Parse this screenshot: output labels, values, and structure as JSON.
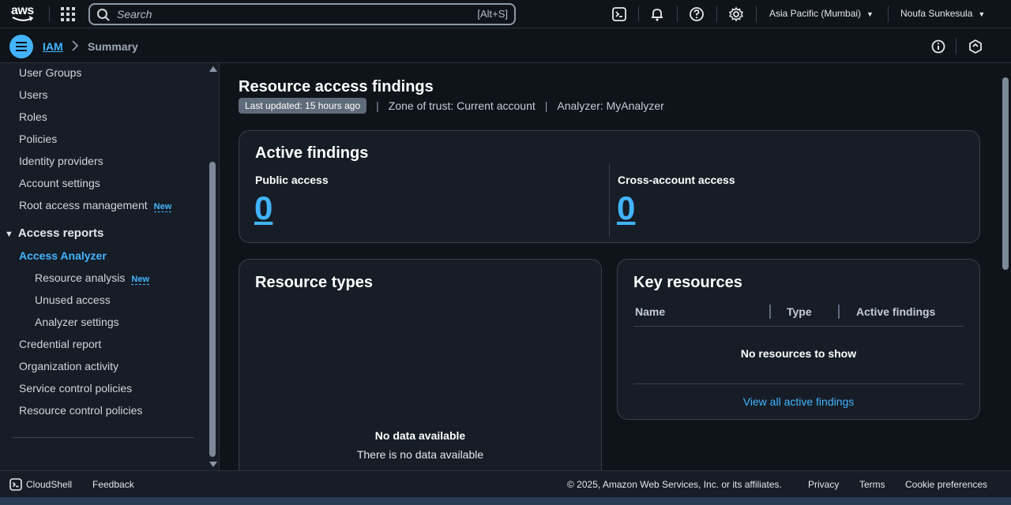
{
  "top_bar": {
    "logo_text": "aws",
    "search_placeholder": "Search",
    "search_shortcut": "[Alt+S]",
    "region": "Asia Pacific (Mumbai)",
    "user": "Noufa Sunkesula"
  },
  "breadcrumb": {
    "service": "IAM",
    "page": "Summary"
  },
  "sidebar": {
    "items": [
      {
        "label": "User Groups"
      },
      {
        "label": "Users"
      },
      {
        "label": "Roles"
      },
      {
        "label": "Policies"
      },
      {
        "label": "Identity providers"
      },
      {
        "label": "Account settings"
      },
      {
        "label": "Root access management",
        "badge": "New"
      }
    ],
    "section": "Access reports",
    "section_items": [
      {
        "label": "Access Analyzer"
      },
      {
        "label": "Resource analysis",
        "badge": "New"
      },
      {
        "label": "Unused access"
      },
      {
        "label": "Analyzer settings"
      },
      {
        "label": "Credential report"
      },
      {
        "label": "Organization activity"
      },
      {
        "label": "Service control policies"
      },
      {
        "label": "Resource control policies"
      }
    ]
  },
  "main": {
    "title": "Resource access findings",
    "last_updated": "Last updated: 15 hours ago",
    "zone": "Zone of trust: Current account",
    "analyzer": "Analyzer: MyAnalyzer",
    "active_findings": {
      "title": "Active findings",
      "public_label": "Public access",
      "public_value": "0",
      "cross_label": "Cross-account access",
      "cross_value": "0"
    },
    "resource_types": {
      "title": "Resource types",
      "nodata_title": "No data available",
      "nodata_sub": "There is no data available"
    },
    "key_resources": {
      "title": "Key resources",
      "columns": [
        "Name",
        "Type",
        "Active findings"
      ],
      "empty": "No resources to show",
      "link": "View all active findings"
    }
  },
  "footer": {
    "cloudshell": "CloudShell",
    "feedback": "Feedback",
    "copyright": "© 2025, Amazon Web Services, Inc. or its affiliates.",
    "privacy": "Privacy",
    "terms": "Terms",
    "cookies": "Cookie preferences"
  },
  "colors": {
    "accent": "#42b4ff",
    "background": "#0f141a",
    "panel": "#161d26"
  }
}
